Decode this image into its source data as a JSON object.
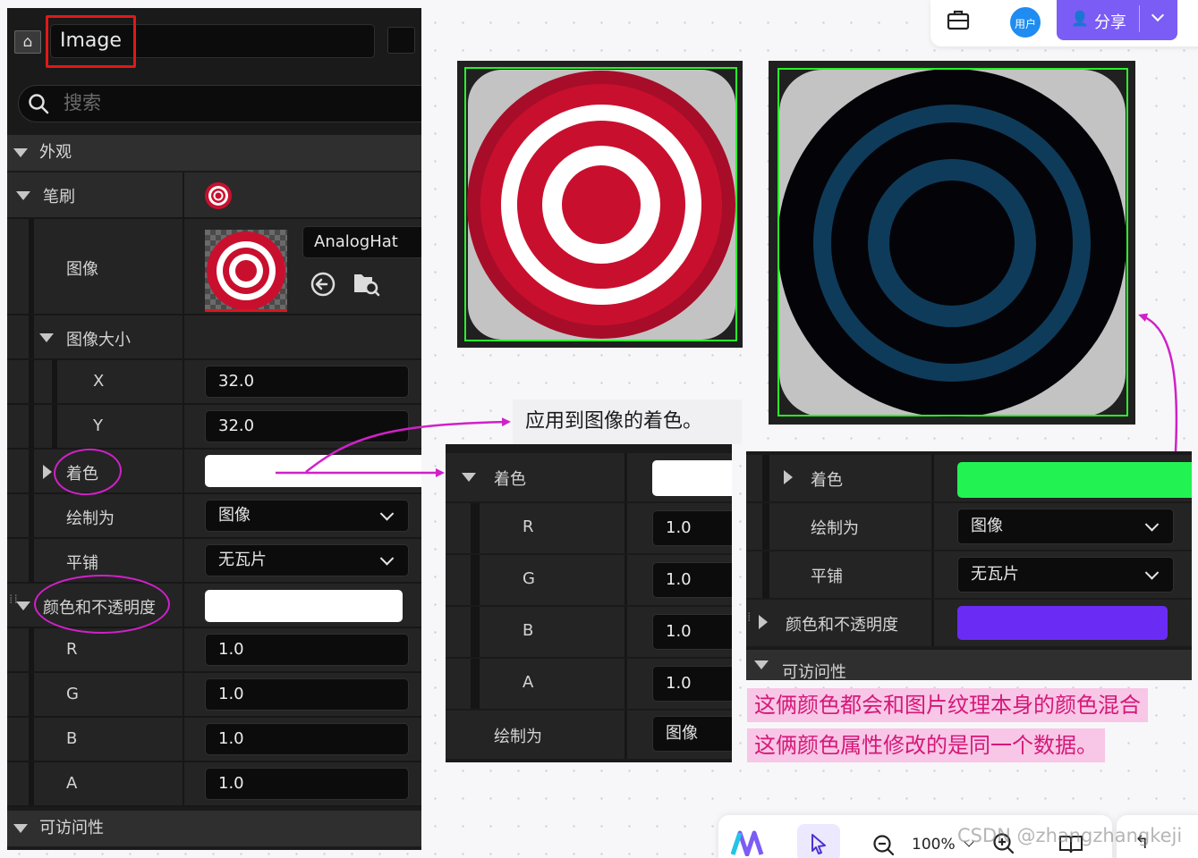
{
  "details": {
    "widget_name": "Image",
    "search_placeholder": "搜索",
    "appearance_category": "外观",
    "brush_label": "笔刷",
    "image_label": "图像",
    "texture_name": "AnalogHat",
    "image_size_label": "图像大小",
    "x_label": "X",
    "x_value": "32.0",
    "y_label": "Y",
    "y_value": "32.0",
    "tint_label": "着色",
    "tint_color": "#ffffff",
    "draw_as_label": "绘制为",
    "draw_as_value": "图像",
    "tiling_label": "平铺",
    "tiling_value": "无瓦片",
    "color_opacity_label": "颜色和不透明度",
    "color_opacity_color": "#ffffff",
    "rgba": [
      {
        "label": "R",
        "value": "1.0"
      },
      {
        "label": "G",
        "value": "1.0"
      },
      {
        "label": "B",
        "value": "1.0"
      },
      {
        "label": "A",
        "value": "1.0"
      }
    ],
    "accessibility_category": "可访问性"
  },
  "callout": {
    "text": "应用到图像的着色。"
  },
  "tint_panel": {
    "tint_label": "着色",
    "tint_color": "#ffffff",
    "rgba": [
      {
        "label": "R",
        "value": "1.0"
      },
      {
        "label": "G",
        "value": "1.0"
      },
      {
        "label": "B",
        "value": "1.0"
      },
      {
        "label": "A",
        "value": "1.0"
      }
    ],
    "draw_as_label": "绘制为",
    "draw_as_value": "图像"
  },
  "right_panel": {
    "tint_label": "着色",
    "tint_color": "#22f352",
    "draw_as_label": "绘制为",
    "draw_as_value": "图像",
    "tiling_label": "平铺",
    "tiling_value": "无瓦片",
    "color_opacity_label": "颜色和不透明度",
    "color_opacity_color": "#6a2cf5",
    "accessibility_label": "可访问性"
  },
  "notes": {
    "line1": "这俩颜色都会和图片纹理本身的颜色混合",
    "line2": "这俩颜色属性修改的是同一个数据。"
  },
  "topbar": {
    "avatar_text": "用户",
    "share_label": "分享"
  },
  "bottombar": {
    "zoom_value": "100%",
    "watermark": "CSDN @zhangzhangkeji"
  },
  "colors": {
    "annotation": "#d021c8",
    "red_box": "#e11818",
    "preview_frame": "#2af02a",
    "note_bg": "#f8c6e6",
    "note_text": "#d41879",
    "share_bg": "#7b5cf5"
  }
}
